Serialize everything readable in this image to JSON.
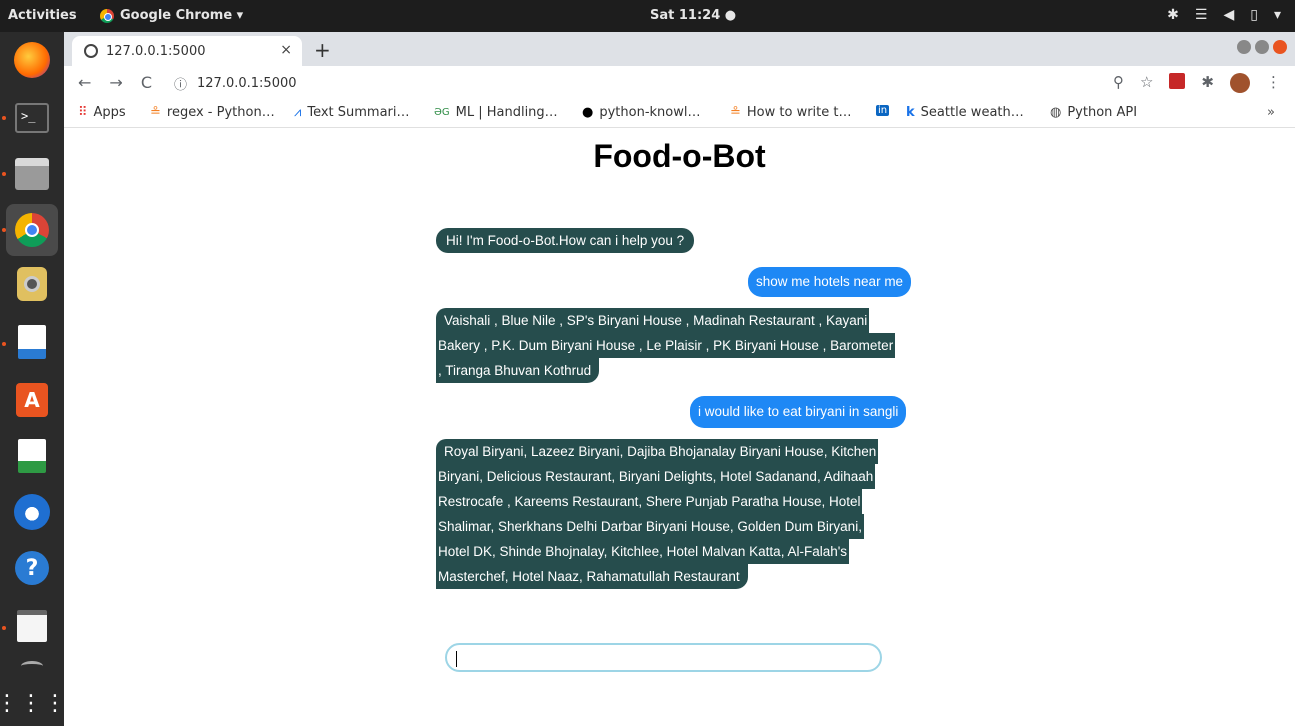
{
  "topbar": {
    "activities": "Activities",
    "app_name": "Google Chrome ▾",
    "clock": "Sat 11:24 ●"
  },
  "browser": {
    "tab_title": "127.0.0.1:5000",
    "tab_close": "×",
    "new_tab": "+",
    "url": "127.0.0.1:5000",
    "bookmarks": [
      {
        "label": "Apps",
        "icon": "apps-grid-icon"
      },
      {
        "label": "regex - Python…",
        "icon": "stackoverflow-icon"
      },
      {
        "label": "Text Summari…",
        "icon": "chart-icon"
      },
      {
        "label": "ML | Handling…",
        "icon": "gfg-icon"
      },
      {
        "label": "python-knowl…",
        "icon": "github-icon"
      },
      {
        "label": "How to write t…",
        "icon": "stackoverflow-icon"
      },
      {
        "label": "Seattle weath…",
        "icon": "k-icon"
      },
      {
        "label": "Python API",
        "icon": "globe-icon"
      }
    ],
    "bookmarks_more": "»"
  },
  "page": {
    "title": "Food-o-Bot",
    "messages": [
      {
        "from": "bot",
        "lines": [
          "Hi! I'm Food-o-Bot.How can i help you ?"
        ]
      },
      {
        "from": "user",
        "lines": [
          "show me hotels near me"
        ]
      },
      {
        "from": "bot",
        "lines": [
          " Vaishali , Blue Nile , SP's Biryani House , Madinah Restaurant , Kayani",
          "Bakery , P.K. Dum Biryani House , Le Plaisir , PK Biryani House , Barometer",
          ", Tiranga Bhuvan Kothrud"
        ]
      },
      {
        "from": "user",
        "lines": [
          "i would like to eat biryani in sangli"
        ]
      },
      {
        "from": "bot",
        "lines": [
          " Royal Biryani, Lazeez Biryani, Dajiba Bhojanalay Biryani House, Kitchen",
          "Biryani, Delicious Restaurant, Biryani Delights, Hotel Sadanand, Adihaah",
          "Restrocafe , Kareems Restaurant, Shere Punjab Paratha House, Hotel",
          "Shalimar, Sherkhans Delhi Darbar Biryani House, Golden Dum Biryani,",
          "Hotel DK, Shinde Bhojnalay, Kitchlee, Hotel Malvan Katta, Al-Falah's",
          "Masterchef, Hotel Naaz, Rahamatullah Restaurant"
        ]
      }
    ],
    "input_value": ""
  },
  "colors": {
    "bot_bubble": "#264d4d",
    "user_bubble": "#1e88f5",
    "input_border": "#9dd5e6"
  }
}
